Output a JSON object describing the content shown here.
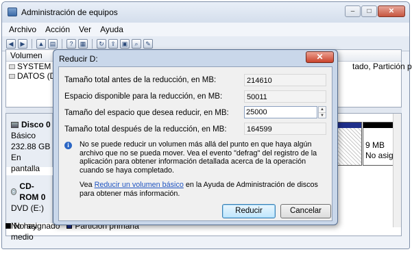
{
  "main_window": {
    "title": "Administración de equipos",
    "controls": {
      "minimize": "–",
      "maximize": "□",
      "close": "✕"
    }
  },
  "menu": [
    "Archivo",
    "Acción",
    "Ver",
    "Ayuda"
  ],
  "toolbar_icons": [
    "back-icon",
    "forward-icon",
    "up-icon",
    "properties-icon",
    "help-icon",
    "view-icon",
    "refresh-icon",
    "export-icon",
    "console-icon",
    "search-icon",
    "action-icon"
  ],
  "volume_list": {
    "header": "Volumen",
    "rows": [
      "SYSTEM (C:",
      "DATOS (D:)"
    ],
    "right_text": "tado, Partición primar"
  },
  "disks": {
    "disk0": {
      "name": "Disco 0",
      "type": "Básico",
      "size": "232.88 GB",
      "status": "En pantalla"
    },
    "disk0_unalloc": {
      "size": "9 MB",
      "state": "No asig"
    },
    "cdrom": {
      "name": "CD-ROM 0",
      "drive": "DVD (E:)",
      "media": "No hay medio"
    }
  },
  "legend": {
    "unallocated": "No asignado",
    "primary": "Partición primaria"
  },
  "dialog": {
    "title": "Reducir D:",
    "close": "✕",
    "fields": {
      "total_before_label": "Tamaño total antes de la reducción, en MB:",
      "total_before_value": "214610",
      "available_label": "Espacio disponible para la reducción, en MB:",
      "available_value": "50011",
      "shrink_label": "Tamaño del espacio que desea reducir, en MB:",
      "shrink_value": "25000",
      "total_after_label": "Tamaño total después de la reducción, en MB:",
      "total_after_value": "164599"
    },
    "info_text": "No se puede reducir un volumen más allá del punto en que haya algún archivo que no se pueda mover. Vea el evento \"defrag\" del registro de la aplicación para obtener información detallada acerca de la operación cuando se haya completado.",
    "help_prefix": "Vea ",
    "help_link": "Reducir un volumen básico",
    "help_suffix": " en la Ayuda de Administración de discos para obtener más información.",
    "buttons": {
      "ok": "Reducir",
      "cancel": "Cancelar"
    }
  }
}
